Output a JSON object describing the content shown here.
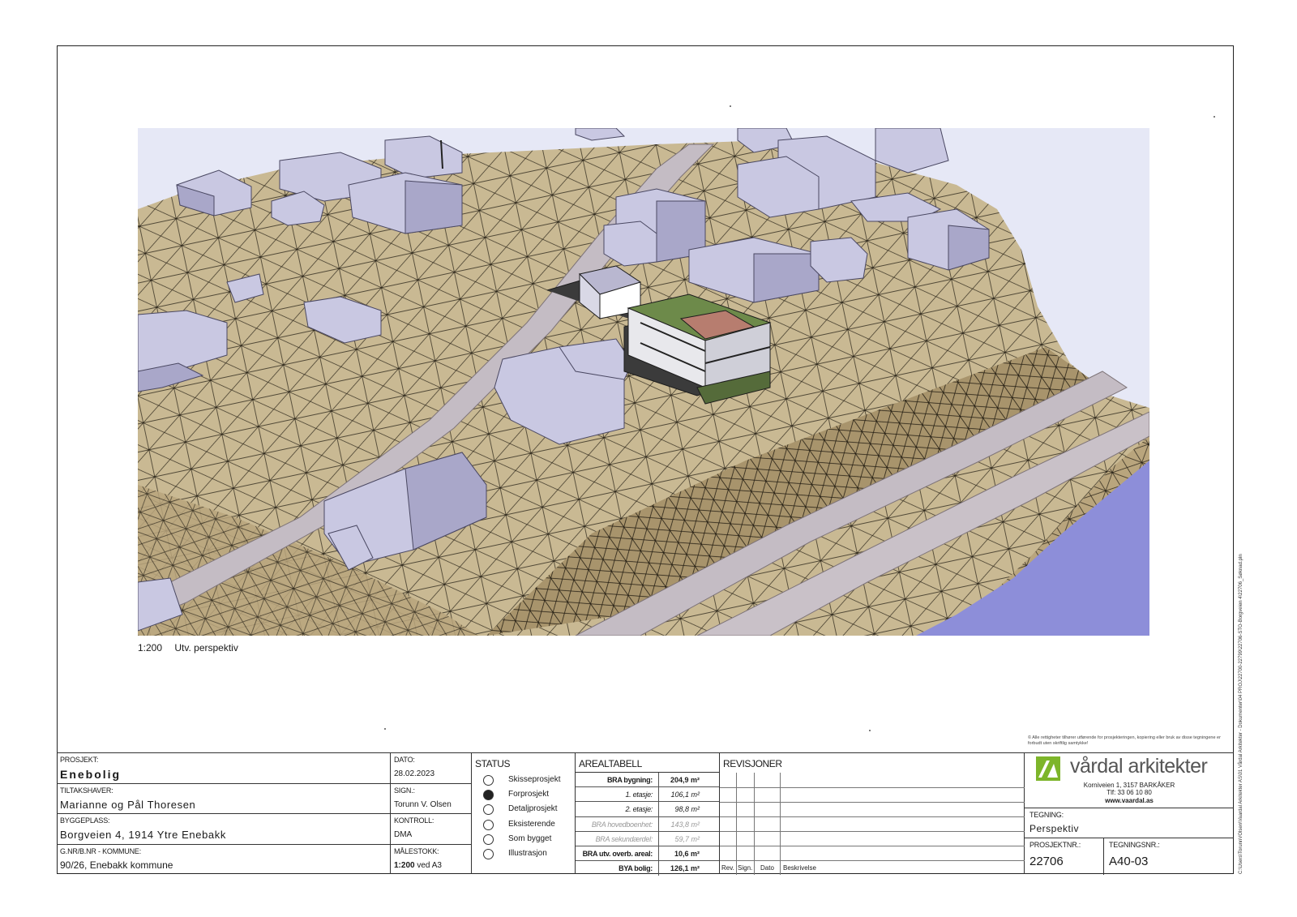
{
  "drawing": {
    "scale": "1:200",
    "view_title": "Utv. perspektiv"
  },
  "copyright_note": "© Alle rettigheter tilhører utførende for prosjekteringen, kopiering eller bruk av disse tegningene er forbudt uten skriftlig samtykke!",
  "file_path": "C:\\Users\\TorunnVOlsen\\Vaardal Arkitekter AS\\01 Vårdal Arkitekter - Dokumenter\\04 PROJ\\22700-22799\\22706-STO-Borgveien 4\\22706_Søknad.pln",
  "project": {
    "prosjekt_label": "PROSJEKT:",
    "prosjekt_value": "Enebolig",
    "tiltakshaver_label": "TILTAKSHAVER:",
    "tiltakshaver_value": "Marianne og Pål Thoresen",
    "byggeplass_label": "BYGGEPLASS:",
    "byggeplass_value": "Borgveien 4, 1914 Ytre Enebakk",
    "gnr_label": "G.NR/B.NR - KOMMUNE:",
    "gnr_value": "90/26, Enebakk kommune"
  },
  "meta": {
    "dato_label": "DATO:",
    "dato_value": "28.02.2023",
    "sign_label": "SIGN.:",
    "sign_value": "Torunn V. Olsen",
    "kontroll_label": "KONTROLL:",
    "kontroll_value": "DMA",
    "malestokk_label": "MÅLESTOKK:",
    "malestokk_value": "1:200",
    "malestokk_suffix": "ved A3"
  },
  "status": {
    "title": "STATUS",
    "items": [
      {
        "label": "Skisseprosjekt",
        "selected": false
      },
      {
        "label": "Forprosjekt",
        "selected": true
      },
      {
        "label": "Detaljprosjekt",
        "selected": false
      },
      {
        "label": "Eksisterende",
        "selected": false
      },
      {
        "label": "Som bygget",
        "selected": false
      },
      {
        "label": "Illustrasjon",
        "selected": false
      }
    ]
  },
  "areal": {
    "title": "AREALTABELL",
    "rows": [
      {
        "label": "BRA bygning:",
        "value": "204,9 m²",
        "style": "bold"
      },
      {
        "label": "1. etasje:",
        "value": "106,1 m²",
        "style": "italic"
      },
      {
        "label": "2. etasje:",
        "value": "98,8 m²",
        "style": "italic"
      },
      {
        "label": "BRA hovedboenhet:",
        "value": "143,8 m²",
        "style": "faint"
      },
      {
        "label": "BRA sekundærdel:",
        "value": "59,7 m²",
        "style": "faint"
      },
      {
        "label": "BRA utv. overb. areal:",
        "value": "10,6 m²",
        "style": "bold"
      },
      {
        "label": "BYA bolig:",
        "value": "126,1 m²",
        "style": "bold"
      }
    ]
  },
  "revisjoner": {
    "title": "REVISJONER",
    "columns": [
      "Rev.",
      "Sign.",
      "Dato",
      "Beskrivelse"
    ]
  },
  "company": {
    "name": "vårdal arkitekter",
    "address": "Korniveien 1, 3157 BARKÅKER",
    "phone": "Tlf: 33 06 10 80",
    "web": "www.vaardal.as",
    "brand_color": "#7db52a"
  },
  "tegning": {
    "label": "TEGNING:",
    "value": "Perspektiv",
    "prosjektnr_label": "PROSJEKTNR.:",
    "prosjektnr_value": "22706",
    "tegningsnr_label": "TEGNINGSNR.:",
    "tegningsnr_value": "A40-03"
  },
  "colors": {
    "terrain": "#c9b993",
    "terrain_dark": "#a8946c",
    "road": "#c4bcc4",
    "building": "#c9c8e2",
    "building_dark": "#a9a7c9",
    "water": "#8d8ed9",
    "sky": "#e6e8f6"
  }
}
